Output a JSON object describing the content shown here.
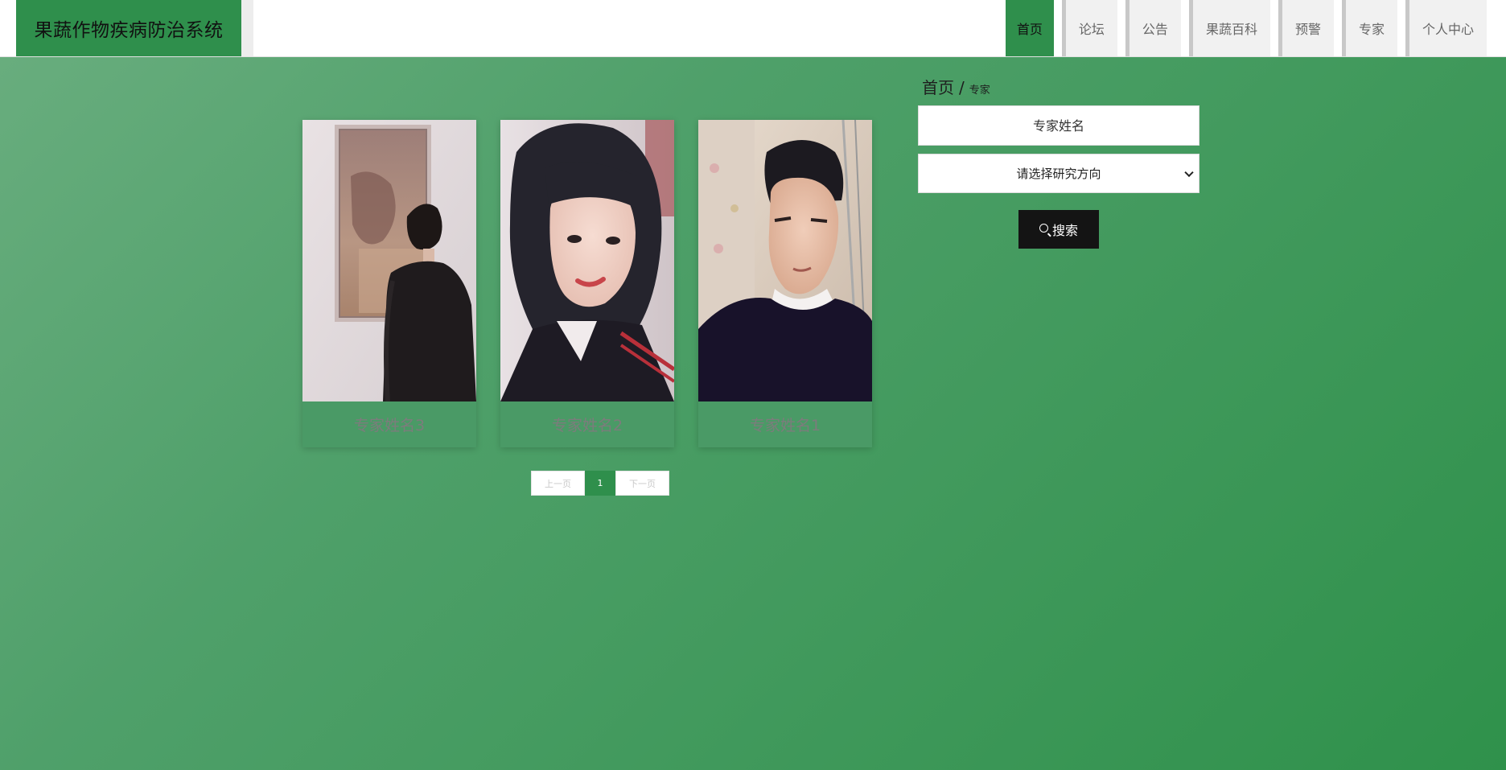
{
  "header": {
    "site_title": "果蔬作物疾病防治系统",
    "nav": [
      {
        "label": "首页",
        "active": true
      },
      {
        "label": "论坛",
        "active": false
      },
      {
        "label": "公告",
        "active": false
      },
      {
        "label": "果蔬百科",
        "active": false
      },
      {
        "label": "预警",
        "active": false
      },
      {
        "label": "专家",
        "active": false
      },
      {
        "label": "个人中心",
        "active": false
      }
    ]
  },
  "breadcrumb": {
    "home": "首页",
    "separator": "/",
    "current": "专家"
  },
  "search": {
    "name_placeholder": "专家姓名",
    "direction_selected": "请选择研究方向",
    "button_label": "搜索"
  },
  "experts": [
    {
      "name": "专家姓名3"
    },
    {
      "name": "专家姓名2"
    },
    {
      "name": "专家姓名1"
    }
  ],
  "pagination": {
    "prev": "上一页",
    "current": "1",
    "next": "下一页"
  },
  "colors": {
    "brand": "#2f8f4c",
    "search_button": "#141414"
  }
}
